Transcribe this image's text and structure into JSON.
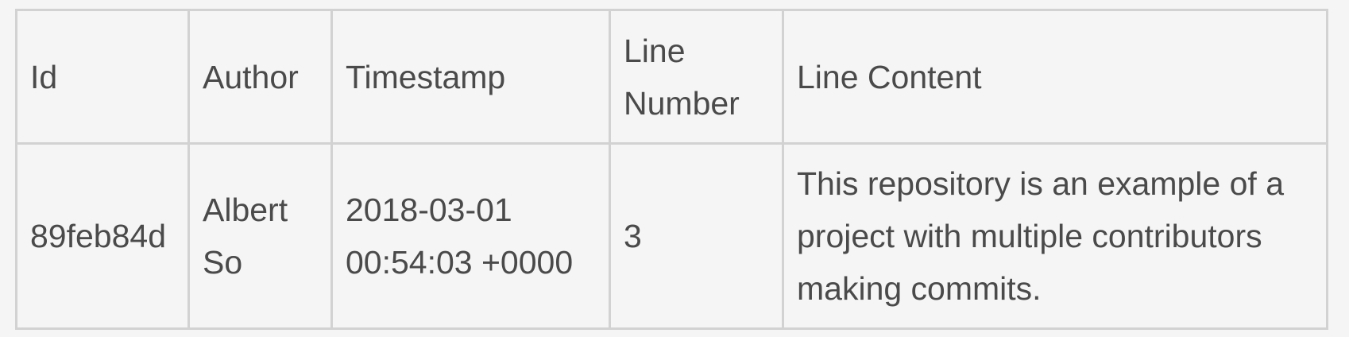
{
  "table": {
    "headers": [
      "Id",
      "Author",
      "Timestamp",
      "Line Number",
      "Line Content"
    ],
    "rows": [
      {
        "id": "89feb84d",
        "author": "Albert So",
        "timestamp": "2018-03-01 00:54:03 +0000",
        "line_number": "3",
        "line_content": "This repository is an example of a project with multiple contributors making commits."
      }
    ]
  },
  "colors": {
    "background": "#f5f5f5",
    "border": "#d2d2d2",
    "text": "#4a4a4a"
  }
}
